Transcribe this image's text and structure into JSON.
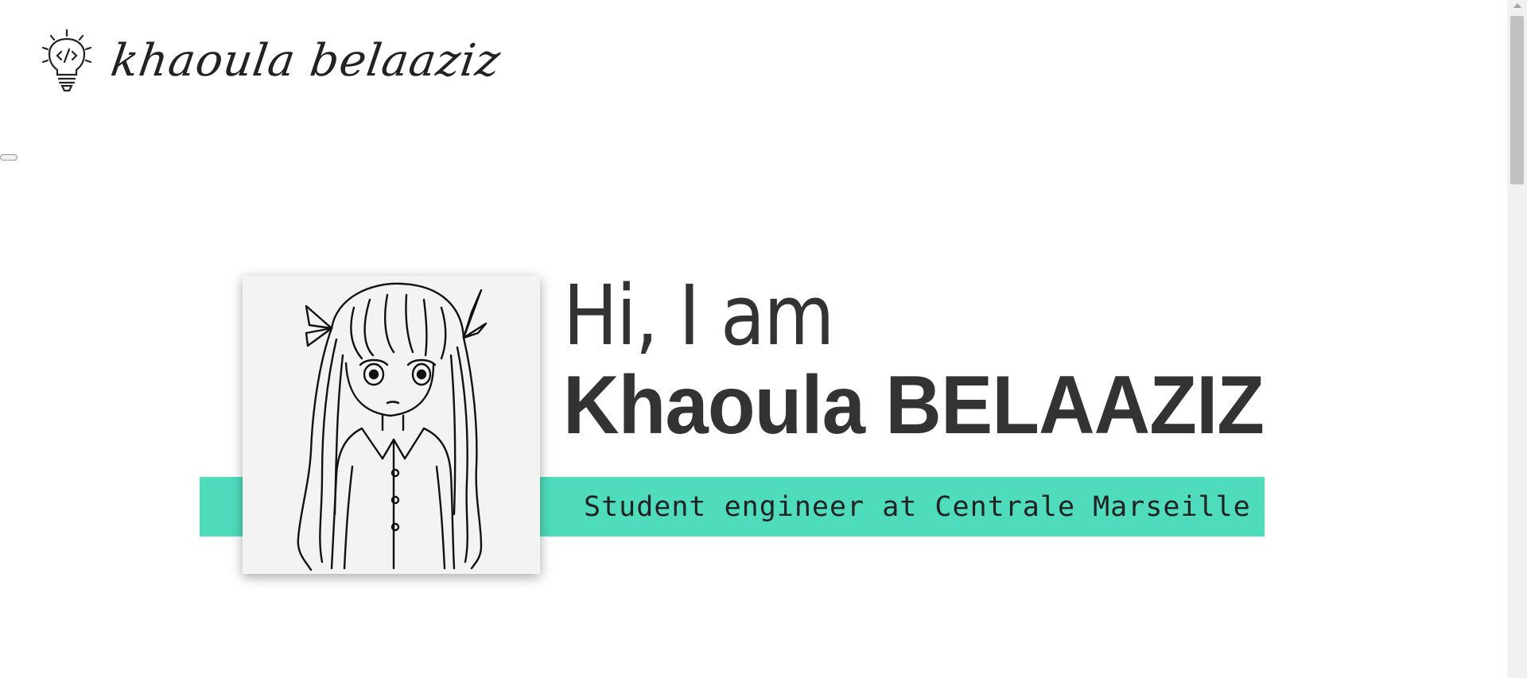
{
  "header": {
    "logo_text": "khaoula belaaziz",
    "logo_icon": "lightbulb-code-icon"
  },
  "nav": {
    "toggle_icon": "menu-toggle"
  },
  "hero": {
    "greeting": "Hi, I am",
    "name": "Khaoula BELAAZIZ",
    "subtitle": "Student engineer at Centrale Marseille",
    "avatar_icon": "avatar-illustration"
  },
  "colors": {
    "accent": "#4edcbd",
    "text": "#333333",
    "background": "#ffffff"
  }
}
